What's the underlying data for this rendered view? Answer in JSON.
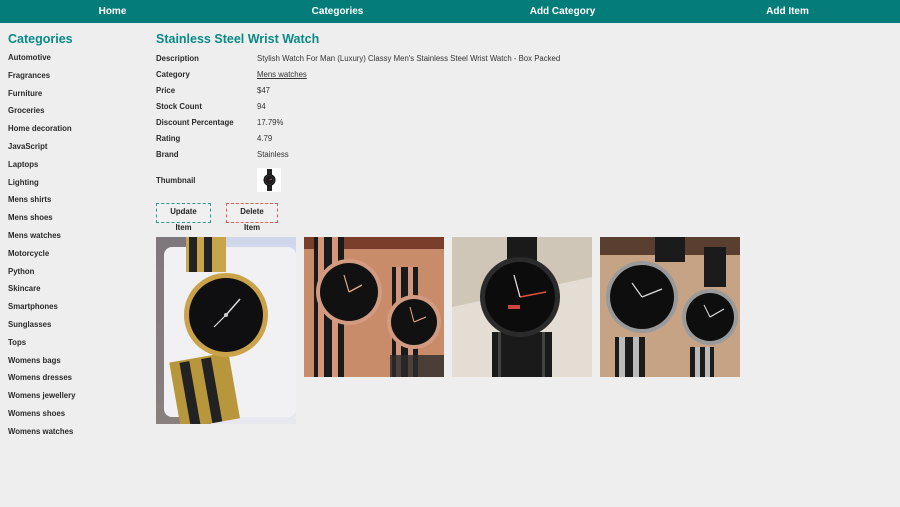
{
  "nav": {
    "home": "Home",
    "categories": "Categories",
    "add_category": "Add Category",
    "add_item": "Add Item"
  },
  "sidebar": {
    "title": "Categories",
    "items": [
      "Automotive",
      "Fragrances",
      "Furniture",
      "Groceries",
      "Home decoration",
      "JavaScript",
      "Laptops",
      "Lighting",
      "Mens shirts",
      "Mens shoes",
      "Mens watches",
      "Motorcycle",
      "Python",
      "Skincare",
      "Smartphones",
      "Sunglasses",
      "Tops",
      "Womens bags",
      "Womens dresses",
      "Womens jewellery",
      "Womens shoes",
      "Womens watches"
    ]
  },
  "product": {
    "title": "Stainless Steel Wrist Watch",
    "fields": {
      "description": {
        "label": "Description",
        "value": "Stylish Watch For Man (Luxury) Classy Men's Stainless Steel Wrist Watch - Box Packed"
      },
      "category": {
        "label": "Category",
        "value": "Mens watches"
      },
      "price": {
        "label": "Price",
        "value": "$47"
      },
      "stock": {
        "label": "Stock Count",
        "value": "94"
      },
      "discount": {
        "label": "Discount Percentage",
        "value": "17.79%"
      },
      "rating": {
        "label": "Rating",
        "value": "4.79"
      },
      "brand": {
        "label": "Brand",
        "value": "Stainless"
      }
    },
    "thumbnail_label": "Thumbnail",
    "update_label": "Update Item",
    "delete_label": "Delete Item",
    "images": [
      {
        "icon": "gold-watch-in-box-photo"
      },
      {
        "icon": "rose-gold-pair-watches-photo"
      },
      {
        "icon": "black-watch-photo"
      },
      {
        "icon": "silver-black-pair-watches-photo"
      }
    ]
  },
  "colors": {
    "nav_bg": "#047d7a",
    "accent": "#0a8a86",
    "update_border": "#2a9a8a",
    "delete_border": "#e05a5a",
    "page_bg": "#efeeee"
  }
}
